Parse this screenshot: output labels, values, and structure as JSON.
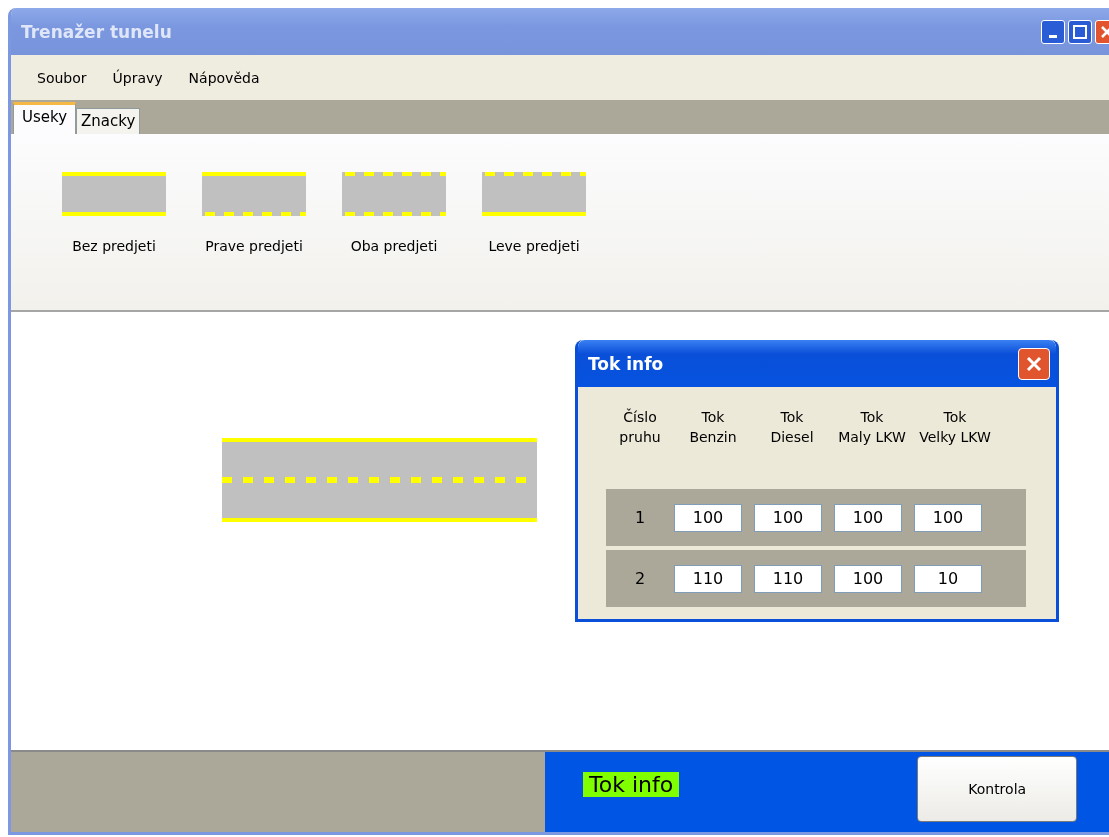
{
  "window": {
    "title": "Trenažer tunelu"
  },
  "menu": [
    "Soubor",
    "Úpravy",
    "Nápověda"
  ],
  "tabs": [
    {
      "label": "Useky",
      "selected": true
    },
    {
      "label": "Znacky",
      "selected": false
    }
  ],
  "segments": [
    {
      "label": "Bez predjeti",
      "top_dashed": false,
      "bottom_dashed": false
    },
    {
      "label": "Prave predjeti",
      "top_dashed": false,
      "bottom_dashed": true
    },
    {
      "label": "Oba predjeti",
      "top_dashed": true,
      "bottom_dashed": true
    },
    {
      "label": "Leve predjeti",
      "top_dashed": true,
      "bottom_dashed": false
    }
  ],
  "dialog": {
    "title": "Tok info",
    "columns": [
      [
        "Číslo",
        "pruhu"
      ],
      [
        "Tok",
        "Benzin"
      ],
      [
        "Tok",
        "Diesel"
      ],
      [
        "Tok",
        "Maly LKW"
      ],
      [
        "Tok",
        "Velky LKW"
      ]
    ],
    "rows": [
      {
        "lane": "1",
        "values": [
          "100",
          "100",
          "100",
          "100"
        ]
      },
      {
        "lane": "2",
        "values": [
          "110",
          "110",
          "100",
          "10"
        ]
      }
    ]
  },
  "status_bar": {
    "label": "Tok info",
    "button": "Kontrola"
  }
}
